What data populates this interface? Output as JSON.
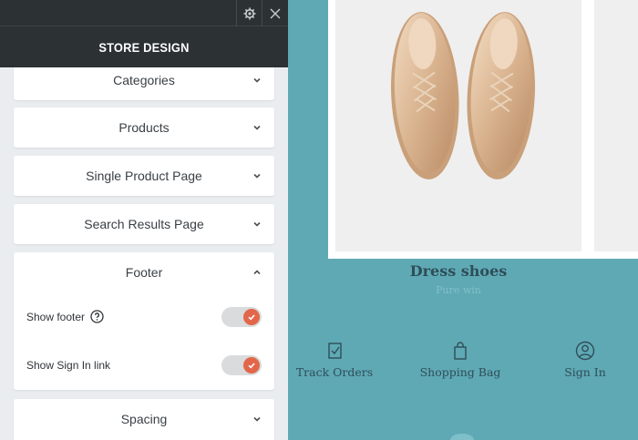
{
  "panel": {
    "title": "STORE DESIGN",
    "sections": [
      {
        "label": "Categories",
        "expanded": false
      },
      {
        "label": "Products",
        "expanded": false
      },
      {
        "label": "Single Product Page",
        "expanded": false
      },
      {
        "label": "Search Results Page",
        "expanded": false
      },
      {
        "label": "Footer",
        "expanded": true
      },
      {
        "label": "Spacing",
        "expanded": false
      }
    ],
    "footer_options": [
      {
        "label": "Show footer",
        "enabled": true
      },
      {
        "label": "Show Sign In link",
        "enabled": true
      }
    ]
  },
  "preview": {
    "product_name": "Dress shoes",
    "product_sub": "Pure win",
    "footer_links": [
      {
        "label": "Track Orders",
        "icon": "track-orders-icon"
      },
      {
        "label": "Shopping Bag",
        "icon": "shopping-bag-icon"
      },
      {
        "label": "Sign In",
        "icon": "sign-in-user-icon"
      }
    ]
  },
  "colors": {
    "teal": "#5fa9b5",
    "dark_header": "#2c3133",
    "toggle_on": "#e2674a"
  }
}
